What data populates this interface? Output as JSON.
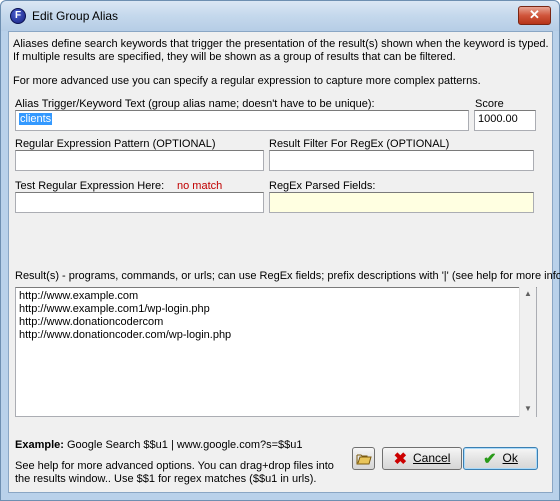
{
  "window": {
    "title": "Edit Group Alias",
    "icon_letter": "F",
    "close_label": "✕"
  },
  "intro": {
    "line1": "Aliases define search keywords that trigger the presentation of the result(s) shown when the keyword is typed.",
    "line2": "If multiple results are specified, they will be shown as a group of results that can be filtered.",
    "line3": "For more advanced use you can specify a regular expression to capture more complex patterns."
  },
  "alias": {
    "label": "Alias Trigger/Keyword Text (group alias name; doesn't have to be unique):",
    "value": "clients"
  },
  "score": {
    "label": "Score",
    "value": "1000.00"
  },
  "regex": {
    "label": "Regular Expression Pattern (OPTIONAL)",
    "value": ""
  },
  "result_filter": {
    "label": "Result Filter For RegEx (OPTIONAL)",
    "value": ""
  },
  "test_regex": {
    "label": "Test Regular Expression Here:",
    "status": "no match",
    "value": ""
  },
  "parsed_fields": {
    "label": "RegEx Parsed Fields:",
    "value": ""
  },
  "results": {
    "label": "Result(s) - programs, commands, or urls; can use RegEx fields; prefix descriptions with '|' (see help for more info)",
    "lines": [
      "http://www.example.com",
      "http://www.example.com1/wp-login.php",
      "http://www.donationcodercom",
      "http://www.donationcoder.com/wp-login.php"
    ]
  },
  "footer": {
    "example_label": "Example:",
    "example_text": "Google Search $$u1 | www.google.com?s=$$u1",
    "help_line1": "See help for more advanced options.  You can drag+drop files into",
    "help_line2": "the results window.. Use $$1 for regex matches ($$u1 in urls)."
  },
  "buttons": {
    "cancel_label": "Cancel",
    "ok_label": "Ok"
  },
  "colors": {
    "no_match": "#c00000",
    "cancel_icon": "#cc0000",
    "ok_icon": "#2a9a1a"
  }
}
